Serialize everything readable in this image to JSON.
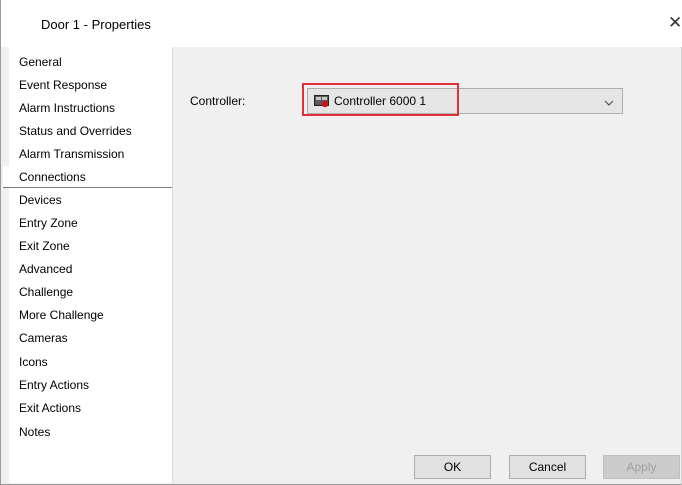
{
  "window": {
    "title": "Door 1 - Properties",
    "close_glyph": "✕"
  },
  "sidebar": {
    "items": [
      {
        "label": "General"
      },
      {
        "label": "Event Response"
      },
      {
        "label": "Alarm Instructions"
      },
      {
        "label": "Status and Overrides"
      },
      {
        "label": "Alarm Transmission"
      },
      {
        "label": "Connections",
        "selected": true
      },
      {
        "label": "Devices"
      },
      {
        "label": "Entry Zone"
      },
      {
        "label": "Exit Zone"
      },
      {
        "label": "Advanced"
      },
      {
        "label": "Challenge"
      },
      {
        "label": "More Challenge"
      },
      {
        "label": "Cameras"
      },
      {
        "label": "Icons"
      },
      {
        "label": "Entry Actions"
      },
      {
        "label": "Exit Actions"
      },
      {
        "label": "Notes"
      }
    ]
  },
  "connections": {
    "controller_label": "Controller:",
    "controller_value": "Controller 6000 1",
    "controller_icon": "controller-icon",
    "highlight_color": "#e0303a"
  },
  "footer": {
    "ok_label": "OK",
    "cancel_label": "Cancel",
    "apply_label": "Apply",
    "apply_enabled": false
  }
}
